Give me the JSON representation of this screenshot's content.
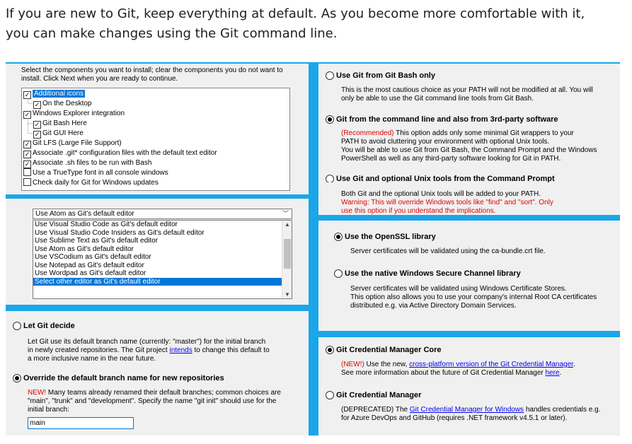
{
  "intro": {
    "line1": "If you are new to Git, keep everything at default. As you become more comfortable with it,",
    "line2": "you can make changes using the Git command line."
  },
  "components": {
    "desc1": "Select the components you want to install; clear the components you do not want to",
    "desc2": "install. Click Next when you are ready to continue.",
    "items": [
      {
        "label": "Additional icons",
        "checked": true,
        "selected": true
      },
      {
        "label": "On the Desktop",
        "checked": true
      },
      {
        "label": "Windows Explorer integration",
        "checked": true
      },
      {
        "label": "Git Bash Here",
        "checked": true
      },
      {
        "label": "Git GUI Here",
        "checked": true
      },
      {
        "label": "Git LFS (Large File Support)",
        "checked": true
      },
      {
        "label": "Associate .git* configuration files with the default text editor",
        "checked": true
      },
      {
        "label": "Associate .sh files to be run with Bash",
        "checked": true
      },
      {
        "label": "Use a TrueType font in all console windows",
        "checked": false
      },
      {
        "label": "Check daily for Git for Windows updates",
        "checked": false
      }
    ]
  },
  "editor": {
    "selected": "Use Atom as Git's default editor",
    "options": [
      "Use Visual Studio Code as Git's default editor",
      "Use Visual Studio Code Insiders as Git's default editor",
      "Use Sublime Text as Git's default editor",
      "Use Atom as Git's default editor",
      "Use VSCodium as Git's default editor",
      "Use Notepad as Git's default editor",
      "Use Wordpad as Git's default editor",
      "Select other editor as Git's default editor"
    ]
  },
  "branch": {
    "opt1_label": "Let Git decide",
    "opt1_d1": "Let Git use its default branch name (currently: \"master\") for the initial branch",
    "opt1_d2a": "in newly created repositories. The Git project ",
    "opt1_d2link": "intends",
    "opt1_d2b": " to change this default to",
    "opt1_d3": "a more inclusive name in the near future.",
    "opt2_label": "Override the default branch name for new repositories",
    "opt2_new": "NEW!",
    "opt2_d1": " Many teams already renamed their default branches; common choices are",
    "opt2_d2": "\"main\", \"trunk\" and \"development\". Specify the name \"git init\" should use for the",
    "opt2_d3": "initial branch:",
    "input_value": "main"
  },
  "path": {
    "opt1_label": "Use Git from Git Bash only",
    "opt1_d1": "This is the most cautious choice as your PATH will not be modified at all. You will",
    "opt1_d2": "only be able to use the Git command line tools from Git Bash.",
    "opt2_label": "Git from the command line and also from 3rd-party software",
    "opt2_rec": "(Recommended)",
    "opt2_d1": " This option adds only some minimal Git wrappers to your",
    "opt2_d2": "PATH to avoid cluttering your environment with optional Unix tools.",
    "opt2_d3": "You will be able to use Git from Git Bash, the Command Prompt and the Windows",
    "opt2_d4": "PowerShell as well as any third-party software looking for Git in PATH.",
    "opt3_label": "Use Git and optional Unix tools from the Command Prompt",
    "opt3_d1": "Both Git and the optional Unix tools will be added to your PATH.",
    "opt3_d2": "Warning: This will override Windows tools like \"find\" and \"sort\". Only",
    "opt3_d3": "use this option if you understand the implications."
  },
  "ssl": {
    "opt1_label": "Use the OpenSSL library",
    "opt1_d1": "Server certificates will be validated using the ca-bundle.crt file.",
    "opt2_label": "Use the native Windows Secure Channel library",
    "opt2_d1": "Server certificates will be validated using Windows Certificate Stores.",
    "opt2_d2": "This option also allows you to use your company's internal Root CA certificates",
    "opt2_d3": "distributed e.g. via Active Directory Domain Services."
  },
  "credential": {
    "opt1_label": "Git Credential Manager Core",
    "opt1_new": "(NEW!)",
    "opt1_d1a": " Use the new, ",
    "opt1_d1link": "cross-platform version of the Git Credential Manager",
    "opt1_d1b": ".",
    "opt1_d2a": "See more information about the future of Git Credential Manager ",
    "opt1_d2link": "here",
    "opt1_d2b": ".",
    "opt2_label": "Git Credential Manager",
    "opt2_d1a": "(DEPRECATED) The ",
    "opt2_d1link": "Git Credential Manager for Windows",
    "opt2_d1b": " handles credentials e.g.",
    "opt2_d2": "for Azure DevOps and GitHub (requires .NET framework v4.5.1 or later)."
  },
  "colors": {
    "accent": "#1aa6e8",
    "panel": "#f0f0f0",
    "selection": "#0078d7",
    "warning": "#e00000"
  }
}
